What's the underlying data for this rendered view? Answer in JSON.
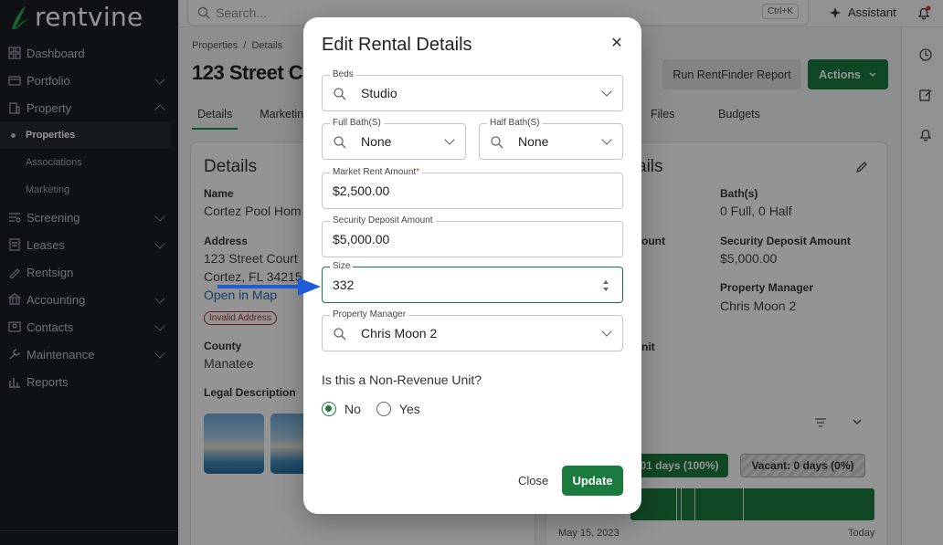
{
  "app": {
    "brand": "rentvine"
  },
  "sidebar": {
    "items": [
      {
        "label": "Dashboard"
      },
      {
        "label": "Portfolio"
      },
      {
        "label": "Property"
      },
      {
        "label": "Screening"
      },
      {
        "label": "Leases"
      },
      {
        "label": "Rentsign"
      },
      {
        "label": "Accounting"
      },
      {
        "label": "Contacts"
      },
      {
        "label": "Maintenance"
      },
      {
        "label": "Reports"
      }
    ],
    "sub_items": [
      {
        "label": "Properties"
      },
      {
        "label": "Associations"
      },
      {
        "label": "Marketing"
      }
    ]
  },
  "topbar": {
    "search_placeholder": "Search...",
    "shortcut": "Ctrl+K",
    "assistant": "Assistant"
  },
  "page": {
    "breadcrumb_1": "Properties",
    "breadcrumb_sep": "/",
    "breadcrumb_2": "Details",
    "title": "123 Street C",
    "tabs": [
      "Details",
      "Marketing",
      "Files",
      "Budgets"
    ],
    "run_rentfinder": "Run RentFinder Report",
    "actions": "Actions"
  },
  "details_card": {
    "heading": "Details",
    "name_label": "Name",
    "name_value": "Cortez Pool Hom",
    "address_label": "Address",
    "address_line1": "123 Street Court",
    "address_line2": "Cortez, FL 34215",
    "open_map": "Open in Map",
    "invalid_badge": "Invalid Address",
    "county_label": "County",
    "county_value": "Manatee",
    "legal_label": "Legal Description"
  },
  "rental_card": {
    "heading": "ails",
    "baths_label": "Bath(s)",
    "baths_value": "0 Full, 0 Half",
    "amount_label_partial": "ount",
    "security_label": "Security Deposit Amount",
    "security_value": "$5,000.00",
    "pm_label": "Property Manager",
    "pm_value": "Chris Moon 2",
    "unit_partial": "nit",
    "occupied_pill": "01 days (100%)",
    "vacant_pill": "Vacant: 0 days (0%)",
    "start_date": "May 15, 2023",
    "end_date": "Today"
  },
  "modal": {
    "title": "Edit Rental Details",
    "beds": {
      "label": "Beds",
      "value": "Studio"
    },
    "full_bath": {
      "label": "Full Bath(S)",
      "value": "None"
    },
    "half_bath": {
      "label": "Half Bath(S)",
      "value": "None"
    },
    "market_rent": {
      "label": "Market Rent Amount",
      "required": "*",
      "value": "$2,500.00"
    },
    "security_deposit": {
      "label": "Security Deposit Amount",
      "value": "$5,000.00"
    },
    "size": {
      "label": "Size",
      "value": "332"
    },
    "property_manager": {
      "label": "Property Manager",
      "value": "Chris Moon 2"
    },
    "non_revenue_question": "Is this a Non-Revenue Unit?",
    "radio_no": "No",
    "radio_yes": "Yes",
    "radio_selected": "No",
    "close_button": "Close",
    "update_button": "Update"
  },
  "colors": {
    "brand_green": "#1b7a3e",
    "sidebar_bg": "#1b2024",
    "annotation_arrow": "#1f5bd8"
  }
}
